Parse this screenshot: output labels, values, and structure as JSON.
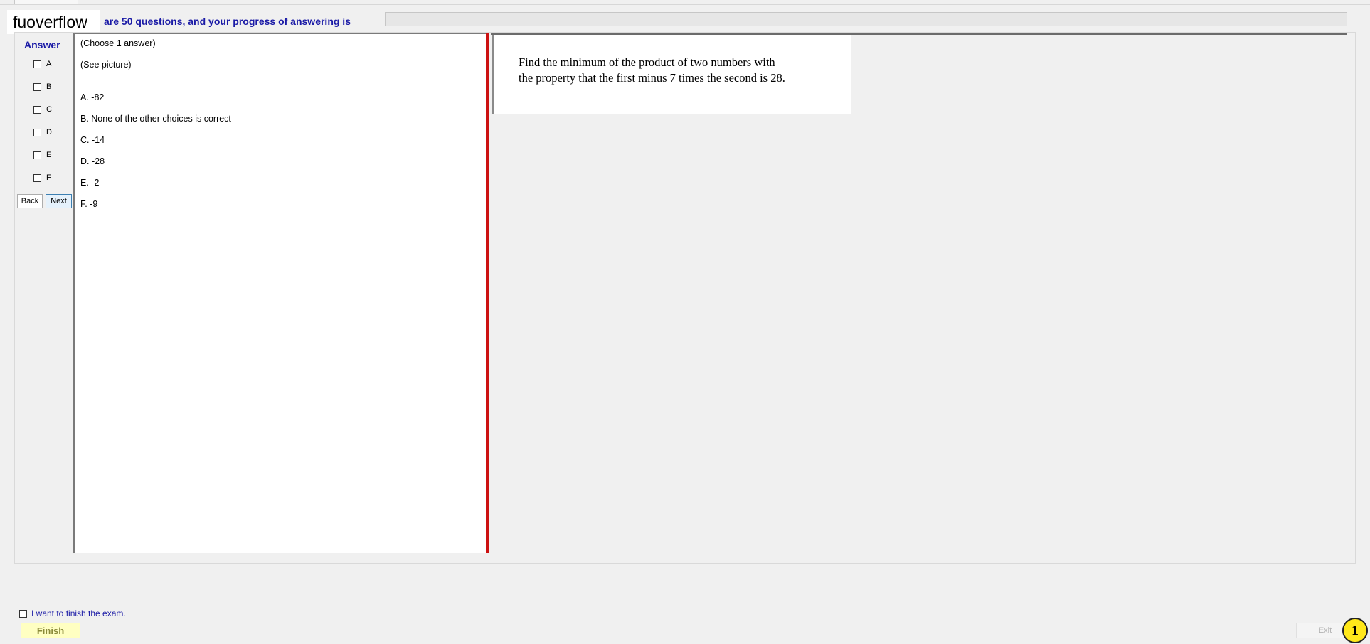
{
  "header": {
    "brand": "fuoverflow",
    "progress_text": "are 50 questions, and your progress of answering is",
    "progress_value": 0
  },
  "answer_panel": {
    "title": "Answer",
    "options": [
      {
        "label": "A",
        "checked": false
      },
      {
        "label": "B",
        "checked": false
      },
      {
        "label": "C",
        "checked": false
      },
      {
        "label": "D",
        "checked": false
      },
      {
        "label": "E",
        "checked": false
      },
      {
        "label": "F",
        "checked": false
      }
    ],
    "back_label": "Back",
    "next_label": "Next"
  },
  "question": {
    "instruction": "(Choose 1 answer)",
    "see_picture": "(See picture)",
    "choices": [
      "A.  -82",
      "B.  None of the other choices is correct",
      "C.  -14",
      "D.  -28",
      "E.  -2",
      "F.  -9"
    ]
  },
  "picture": {
    "line1": "Find the minimum of the product of two numbers with",
    "line2": "the property that the first minus 7 times the second is 28."
  },
  "footer": {
    "finish_checkbox_label": "I want to finish the exam.",
    "finish_label": "Finish",
    "exit_label": "Exit",
    "badge": "1"
  },
  "colors": {
    "accent_blue": "#1a1aa6",
    "splitter_red": "#cc1111",
    "finish_bg": "#ffffc2",
    "badge_yellow": "#ffe81a"
  }
}
